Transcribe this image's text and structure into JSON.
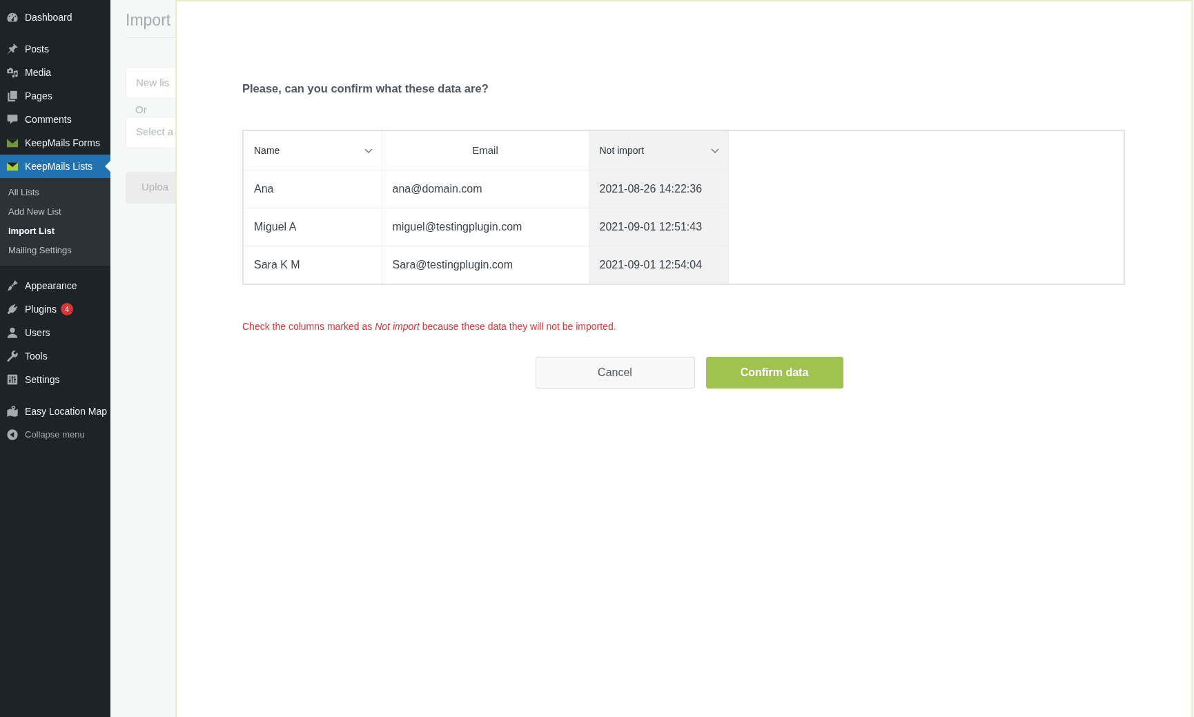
{
  "sidebar": {
    "groups": [
      [
        {
          "label": "Dashboard",
          "selected": false
        }
      ],
      [
        {
          "label": "Posts",
          "selected": false
        },
        {
          "label": "Media",
          "selected": false
        },
        {
          "label": "Pages",
          "selected": false
        },
        {
          "label": "Comments",
          "selected": false
        },
        {
          "label": "KeepMails Forms",
          "selected": false
        },
        {
          "label": "KeepMails Lists",
          "selected": true,
          "children": [
            {
              "label": "All Lists",
              "selected": false
            },
            {
              "label": "Add New List",
              "selected": false
            },
            {
              "label": "Import List",
              "selected": true
            },
            {
              "label": "Mailing Settings",
              "selected": false
            }
          ]
        }
      ],
      [
        {
          "label": "Appearance",
          "selected": false
        },
        {
          "label": "Plugins",
          "selected": false,
          "badge": "4"
        },
        {
          "label": "Users",
          "selected": false
        },
        {
          "label": "Tools",
          "selected": false
        },
        {
          "label": "Settings",
          "selected": false
        }
      ],
      [
        {
          "label": "Easy Location Map",
          "selected": false
        }
      ]
    ],
    "collapse_menu": {
      "label": "Collapse menu"
    }
  },
  "page": {
    "title": "Import",
    "list_name_field": {
      "placeholder": "New lis"
    },
    "separator_label": "Or",
    "list_select": {
      "value": "Select a"
    },
    "upload_button": {
      "label": "Uploa"
    }
  },
  "modal": {
    "question": "Please, can you confirm what these data are?",
    "table": {
      "columns": [
        {
          "label": "Name",
          "kind": "select",
          "ignored": false
        },
        {
          "label": "Email",
          "kind": "text",
          "ignored": false
        },
        {
          "label": "Not import",
          "kind": "select",
          "ignored": true
        }
      ],
      "rows": [
        [
          "Ana",
          "ana@domain.com",
          "2021-08-26 14:22:36"
        ],
        [
          "Miguel A",
          "miguel@testingplugin.com",
          "2021-09-01 12:51:43"
        ],
        [
          "Sara K M",
          "Sara@testingplugin.com",
          "2021-09-01 12:54:04"
        ]
      ]
    },
    "notice": "Check the columns marked as *Not import* because these data they will not be imported.",
    "buttons": [
      {
        "label": "Cancel",
        "kind": "secondary"
      },
      {
        "label": "Confirm data",
        "kind": "primary"
      }
    ]
  }
}
